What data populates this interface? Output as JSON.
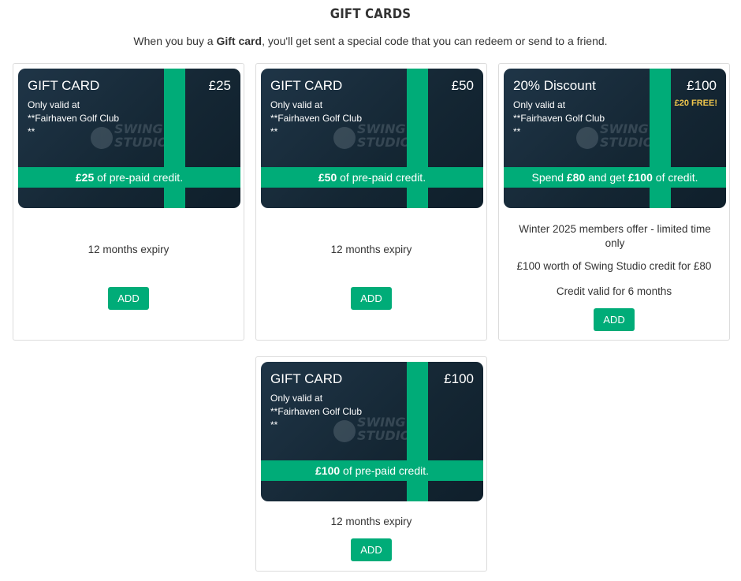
{
  "header": {
    "title": "GIFT CARDS",
    "intro_before": "When you buy a ",
    "intro_bold": "Gift card",
    "intro_after": ", you'll get sent a special code that you can redeem or send to a friend."
  },
  "watermark": {
    "line1": "SWING",
    "line2": "STUDIO"
  },
  "colors": {
    "accent": "#00ac78",
    "card_dark": "#142633",
    "highlight": "#f0c64c"
  },
  "cards": [
    {
      "title": "GIFT CARD",
      "amount": "£25",
      "valid_line1": "Only valid at",
      "valid_line2": "**Fairhaven Golf Club",
      "valid_line3": "**",
      "ribbon_bold": "£25",
      "ribbon_text": " of pre-paid credit.",
      "desc1": "12 months expiry",
      "button": "ADD"
    },
    {
      "title": "GIFT CARD",
      "amount": "£50",
      "valid_line1": "Only valid at",
      "valid_line2": "**Fairhaven Golf Club",
      "valid_line3": "**",
      "ribbon_bold": "£50",
      "ribbon_text": " of pre-paid credit.",
      "desc1": "12 months expiry",
      "button": "ADD"
    },
    {
      "title": "20% Discount",
      "amount": "£100",
      "extra": "£20 FREE!",
      "valid_line1": "Only valid at",
      "valid_line2": "**Fairhaven Golf Club",
      "valid_line3": "**",
      "ribbon_pre": "Spend ",
      "ribbon_bold1": "£80",
      "ribbon_mid": " and get ",
      "ribbon_bold2": "£100",
      "ribbon_post": " of credit.",
      "desc1": "Winter 2025 members offer - limited time only",
      "desc2": "£100 worth of Swing Studio credit for £80",
      "desc3": "Credit valid for 6 months",
      "button": "ADD"
    },
    {
      "title": "GIFT CARD",
      "amount": "£100",
      "valid_line1": "Only valid at",
      "valid_line2": "**Fairhaven Golf Club",
      "valid_line3": "**",
      "ribbon_bold": "£100",
      "ribbon_text": " of pre-paid credit.",
      "desc1": "12 months expiry",
      "button": "ADD"
    }
  ]
}
